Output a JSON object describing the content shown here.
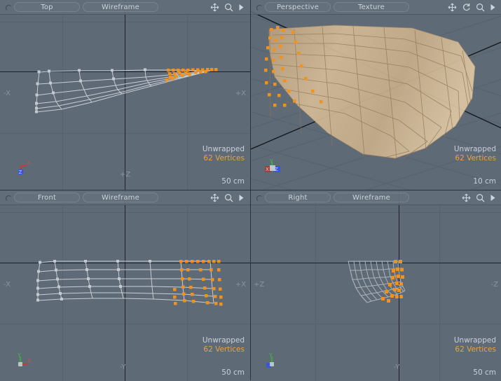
{
  "app": {
    "accent_selected": "#f0921f",
    "bg_viewport": "#5f6a77",
    "text_color": "#c9d1da"
  },
  "viewports": [
    {
      "id": "top-left",
      "view_label": "Top",
      "shading_label": "Wireframe",
      "status_name": "Unwrapped",
      "status_vertices": "62 Vertices",
      "scale": "50 cm",
      "axis_left": "-X",
      "axis_right": "+X",
      "axis_bottom": "+Z",
      "gizmo_axes": [
        "X",
        "Z"
      ],
      "icons": [
        "move-icon",
        "zoom-icon",
        "play-icon"
      ]
    },
    {
      "id": "top-right",
      "view_label": "Perspective",
      "shading_label": "Texture",
      "status_name": "Unwrapped",
      "status_vertices": "62 Vertices",
      "scale": "10 cm",
      "axis_left": "",
      "axis_right": "",
      "axis_bottom": "",
      "gizmo_axes": [
        "X",
        "Y",
        "Z"
      ],
      "icons": [
        "move-icon",
        "rotate-icon",
        "zoom-icon",
        "play-icon"
      ]
    },
    {
      "id": "bottom-left",
      "view_label": "Front",
      "shading_label": "Wireframe",
      "status_name": "Unwrapped",
      "status_vertices": "62 Vertices",
      "scale": "50 cm",
      "axis_left": "-X",
      "axis_right": "+X",
      "axis_bottom": "-Y",
      "gizmo_axes": [
        "X",
        "Y"
      ],
      "icons": [
        "move-icon",
        "zoom-icon",
        "play-icon"
      ]
    },
    {
      "id": "bottom-right",
      "view_label": "Right",
      "shading_label": "Wireframe",
      "status_name": "Unwrapped",
      "status_vertices": "62 Vertices",
      "scale": "50 cm",
      "axis_left": "+Z",
      "axis_right": "-Z",
      "axis_bottom": "-Y",
      "gizmo_axes": [
        "Y",
        "Z"
      ],
      "icons": [
        "move-icon",
        "zoom-icon",
        "play-icon"
      ]
    }
  ]
}
